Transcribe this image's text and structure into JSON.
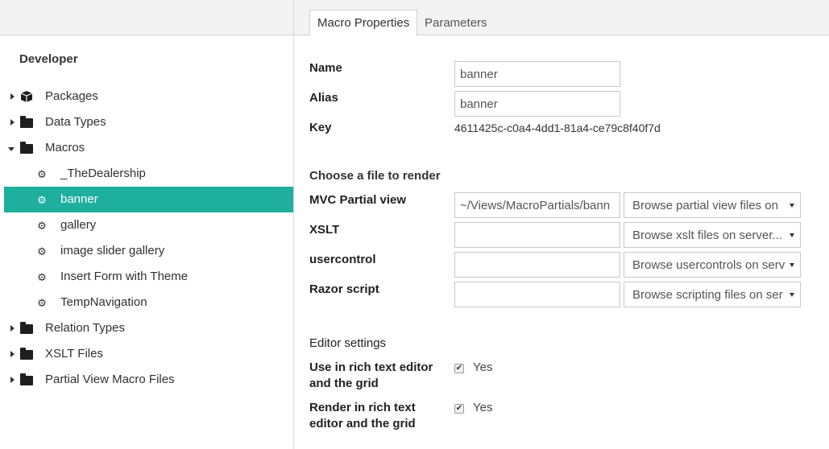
{
  "sidebar": {
    "title": "Developer",
    "items": [
      {
        "label": "Packages",
        "icon": "package-icon",
        "caret": "right"
      },
      {
        "label": "Data Types",
        "icon": "folder-icon",
        "caret": "right"
      },
      {
        "label": "Macros",
        "icon": "folder-icon",
        "caret": "down"
      },
      {
        "label": "_TheDealership",
        "icon": "gears-icon"
      },
      {
        "label": "banner",
        "icon": "gears-icon",
        "selected": true
      },
      {
        "label": "gallery",
        "icon": "gears-icon"
      },
      {
        "label": "image slider gallery",
        "icon": "gears-icon"
      },
      {
        "label": "Insert Form with Theme",
        "icon": "gears-icon"
      },
      {
        "label": "TempNavigation",
        "icon": "gears-icon"
      },
      {
        "label": "Relation Types",
        "icon": "folder-icon",
        "caret": "right"
      },
      {
        "label": "XSLT Files",
        "icon": "folder-icon",
        "caret": "right"
      },
      {
        "label": "Partial View Macro Files",
        "icon": "folder-icon",
        "caret": "right"
      }
    ]
  },
  "tabs": [
    {
      "label": "Macro Properties",
      "active": true
    },
    {
      "label": "Parameters",
      "active": false
    }
  ],
  "properties": {
    "name_label": "Name",
    "name_value": "banner",
    "alias_label": "Alias",
    "alias_value": "banner",
    "key_label": "Key",
    "key_value": "4611425c-c0a4-4dd1-81a4-ce79c8f40f7d"
  },
  "render": {
    "heading": "Choose a file to render",
    "rows": [
      {
        "label": "MVC Partial view",
        "value": "~/Views/MacroPartials/bann",
        "select": "Browse partial view files on"
      },
      {
        "label": "XSLT",
        "value": "",
        "select": "Browse xslt files on server..."
      },
      {
        "label": "usercontrol",
        "value": "",
        "select": "Browse usercontrols on serv"
      },
      {
        "label": "Razor script",
        "value": "",
        "select": "Browse scripting files on ser"
      }
    ]
  },
  "editor": {
    "heading": "Editor settings",
    "use_rte_label_1": "Use in rich text editor",
    "use_rte_label_2": "and the grid",
    "use_rte_value": "Yes",
    "render_rte_label_1": "Render in rich text",
    "render_rte_label_2": "editor and the grid",
    "render_rte_value": "Yes"
  },
  "colors": {
    "selected_bg": "#1eaf9f",
    "panel_bg": "#f3f3f3"
  }
}
